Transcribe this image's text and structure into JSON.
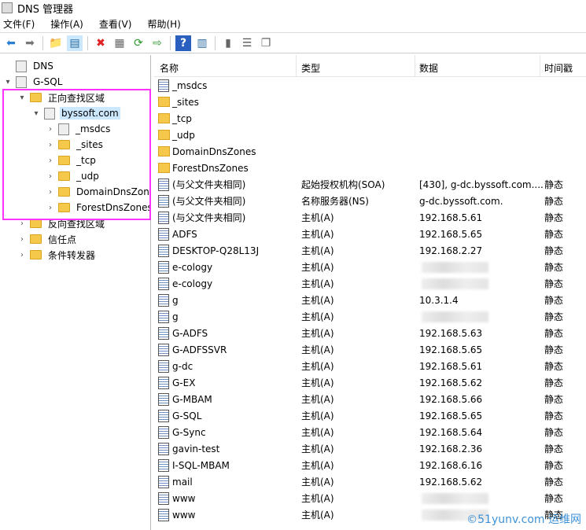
{
  "window": {
    "title": "DNS 管理器"
  },
  "menu": [
    "文件(F)",
    "操作(A)",
    "查看(V)",
    "帮助(H)"
  ],
  "toolbar": [
    "back-icon",
    "forward-icon",
    "up-folder-icon",
    "show-hide-tree-icon",
    "delete-icon",
    "properties-icon",
    "refresh-icon",
    "export-icon",
    "help-icon",
    "show-action-pane-icon",
    "server-icon",
    "list-icon",
    "copy-icon"
  ],
  "tree": [
    {
      "label": "DNS",
      "level": 0,
      "arrow": "",
      "icon": "dns"
    },
    {
      "label": "G-SQL",
      "level": 0,
      "arrow": "▾",
      "icon": "server"
    },
    {
      "label": "正向查找区域",
      "level": 1,
      "arrow": "▾",
      "icon": "folder"
    },
    {
      "label": "byssoft.com",
      "level": 2,
      "arrow": "▾",
      "icon": "zone",
      "selected": true
    },
    {
      "label": "_msdcs",
      "level": 3,
      "arrow": "›",
      "icon": "zone"
    },
    {
      "label": "_sites",
      "level": 3,
      "arrow": "›",
      "icon": "folder"
    },
    {
      "label": "_tcp",
      "level": 3,
      "arrow": "›",
      "icon": "folder"
    },
    {
      "label": "_udp",
      "level": 3,
      "arrow": "›",
      "icon": "folder"
    },
    {
      "label": "DomainDnsZones",
      "level": 3,
      "arrow": "›",
      "icon": "folder"
    },
    {
      "label": "ForestDnsZones",
      "level": 3,
      "arrow": "›",
      "icon": "folder"
    },
    {
      "label": "反向查找区域",
      "level": 1,
      "arrow": "›",
      "icon": "folder"
    },
    {
      "label": "信任点",
      "level": 1,
      "arrow": "›",
      "icon": "folder"
    },
    {
      "label": "条件转发器",
      "level": 1,
      "arrow": "›",
      "icon": "folder"
    }
  ],
  "columns": [
    "名称",
    "类型",
    "数据",
    "时间戳"
  ],
  "rows": [
    {
      "name": "_msdcs",
      "type": "",
      "data": "",
      "ts": "",
      "icon": "zone"
    },
    {
      "name": "_sites",
      "type": "",
      "data": "",
      "ts": "",
      "icon": "folder"
    },
    {
      "name": "_tcp",
      "type": "",
      "data": "",
      "ts": "",
      "icon": "folder"
    },
    {
      "name": "_udp",
      "type": "",
      "data": "",
      "ts": "",
      "icon": "folder"
    },
    {
      "name": "DomainDnsZones",
      "type": "",
      "data": "",
      "ts": "",
      "icon": "folder"
    },
    {
      "name": "ForestDnsZones",
      "type": "",
      "data": "",
      "ts": "",
      "icon": "folder"
    },
    {
      "name": "(与父文件夹相同)",
      "type": "起始授权机构(SOA)",
      "data": "[430], g-dc.byssoft.com....",
      "ts": "静态",
      "icon": "record"
    },
    {
      "name": "(与父文件夹相同)",
      "type": "名称服务器(NS)",
      "data": "g-dc.byssoft.com.",
      "ts": "静态",
      "icon": "record"
    },
    {
      "name": "(与父文件夹相同)",
      "type": "主机(A)",
      "data": "192.168.5.61",
      "ts": "静态",
      "icon": "record"
    },
    {
      "name": "ADFS",
      "type": "主机(A)",
      "data": "192.168.5.65",
      "ts": "静态",
      "icon": "record"
    },
    {
      "name": "DESKTOP-Q28L13J",
      "type": "主机(A)",
      "data": "192.168.2.27",
      "ts": "静态",
      "icon": "record"
    },
    {
      "name": "e-cology",
      "type": "主机(A)",
      "data": "",
      "ts": "静态",
      "icon": "record",
      "blurred": true
    },
    {
      "name": "e-cology",
      "type": "主机(A)",
      "data": "",
      "ts": "静态",
      "icon": "record",
      "blurred": true
    },
    {
      "name": "g",
      "type": "主机(A)",
      "data": "10.3.1.4",
      "ts": "静态",
      "icon": "record"
    },
    {
      "name": "g",
      "type": "主机(A)",
      "data": "",
      "ts": "静态",
      "icon": "record",
      "blurred": true
    },
    {
      "name": "G-ADFS",
      "type": "主机(A)",
      "data": "192.168.5.63",
      "ts": "静态",
      "icon": "record"
    },
    {
      "name": "G-ADFSSVR",
      "type": "主机(A)",
      "data": "192.168.5.65",
      "ts": "静态",
      "icon": "record"
    },
    {
      "name": "g-dc",
      "type": "主机(A)",
      "data": "192.168.5.61",
      "ts": "静态",
      "icon": "record"
    },
    {
      "name": "G-EX",
      "type": "主机(A)",
      "data": "192.168.5.62",
      "ts": "静态",
      "icon": "record"
    },
    {
      "name": "G-MBAM",
      "type": "主机(A)",
      "data": "192.168.5.66",
      "ts": "静态",
      "icon": "record"
    },
    {
      "name": "G-SQL",
      "type": "主机(A)",
      "data": "192.168.5.65",
      "ts": "静态",
      "icon": "record"
    },
    {
      "name": "G-Sync",
      "type": "主机(A)",
      "data": "192.168.5.64",
      "ts": "静态",
      "icon": "record"
    },
    {
      "name": "gavin-test",
      "type": "主机(A)",
      "data": "192.168.2.36",
      "ts": "静态",
      "icon": "record"
    },
    {
      "name": "I-SQL-MBAM",
      "type": "主机(A)",
      "data": "192.168.6.16",
      "ts": "静态",
      "icon": "record"
    },
    {
      "name": "mail",
      "type": "主机(A)",
      "data": "192.168.5.62",
      "ts": "静态",
      "icon": "record"
    },
    {
      "name": "www",
      "type": "主机(A)",
      "data": "",
      "ts": "静态",
      "icon": "record",
      "blurred": true
    },
    {
      "name": "www",
      "type": "主机(A)",
      "data": "",
      "ts": "静态",
      "icon": "record",
      "blurred": true
    }
  ],
  "watermark": "©51yunv.com 运维网",
  "colors": {
    "highlight": "#ff33ff",
    "selection": "#cce8ff"
  }
}
